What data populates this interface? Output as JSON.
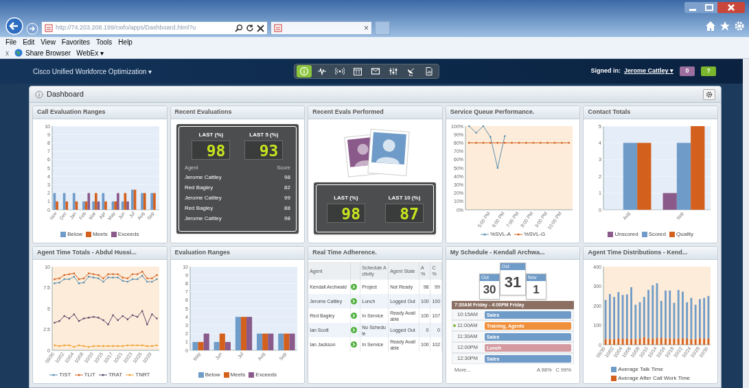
{
  "browser": {
    "url": "http://74.203.208.199/cwfo/apps/Dashboard.html?u",
    "tab_close": "×",
    "menu": [
      "File",
      "Edit",
      "View",
      "Favorites",
      "Tools",
      "Help"
    ],
    "toolbar": {
      "close": "x",
      "share": "Share Browser",
      "webex": "WebEx ▾"
    }
  },
  "app": {
    "title": "Cisco Unified Workforce Optimization ▾",
    "tools": [
      {
        "kind": "info",
        "selected": true
      },
      {
        "kind": "pulse",
        "selected": false
      },
      {
        "kind": "signal",
        "selected": false
      },
      {
        "kind": "calendar",
        "selected": false
      },
      {
        "kind": "mail",
        "selected": false
      },
      {
        "kind": "sliders",
        "selected": false
      },
      {
        "kind": "dish",
        "selected": false
      },
      {
        "kind": "report",
        "selected": false
      }
    ],
    "signed_in_label": "Signed in:",
    "user": "Jerome Cattley ▾",
    "badges": [
      {
        "text": "0",
        "color": "#9c6f9e"
      },
      {
        "text": "?",
        "color": "#7cb62e"
      }
    ]
  },
  "dashboard": {
    "title": "Dashboard",
    "widgets": [
      {
        "kind": "chart",
        "title": "Call Evaluation Ranges",
        "chart_data": {
          "type": "bar",
          "categories": [
            "Nov",
            "Dec",
            "Jan",
            "Feb",
            "Mar",
            "Apr",
            "May",
            "Jun",
            "Jul",
            "Aug",
            "Sep"
          ],
          "grid": true,
          "ylim": [
            0,
            10
          ],
          "yticks": [
            0,
            1,
            2,
            3,
            4,
            5,
            6,
            7,
            8,
            9,
            10
          ],
          "series": [
            {
              "name": "Below",
              "color": "#6f9bc8",
              "values": [
                2,
                2,
                2,
                1,
                1,
                2,
                1,
                1,
                2.4,
                2,
                2
              ]
            },
            {
              "name": "Meets",
              "color": "#d4601e",
              "values": [
                1,
                1,
                1,
                1,
                2,
                1,
                1,
                2,
                2.4,
                2,
                2
              ]
            },
            {
              "name": "Exceeds",
              "color": "#8a5a8a",
              "values": [
                0,
                0,
                0,
                2,
                1,
                0,
                2,
                1,
                0,
                0,
                0
              ]
            }
          ]
        }
      },
      {
        "kind": "scoreboard",
        "title": "Recent Evaluations",
        "scores": [
          {
            "label": "LAST (%)",
            "value": "98"
          },
          {
            "label": "LAST 5 (%)",
            "value": "93"
          }
        ],
        "columns": [
          "Agent",
          "Score"
        ],
        "rows": [
          [
            "Jerome Cattley",
            "98"
          ],
          [
            "Red Bagley",
            "82"
          ],
          [
            "Jerome Cattley",
            "99"
          ],
          [
            "Red Bagley",
            "88"
          ],
          [
            "Jerome Cattley",
            "98"
          ]
        ]
      },
      {
        "kind": "evals",
        "title": "Recent Evals Performed",
        "scores": [
          {
            "label": "LAST (%)",
            "value": "98"
          },
          {
            "label": "LAST 10 (%)",
            "value": "87"
          }
        ]
      },
      {
        "kind": "chart",
        "title": "Service Queue Performance.",
        "chart_data": {
          "type": "line",
          "categories": [
            null,
            null,
            null,
            "5:00 PM",
            null,
            "6:00 PM",
            null,
            "7:00 PM",
            null,
            "8:00 PM",
            null,
            "9:00 PM",
            null,
            "10:00 PM",
            null
          ],
          "ylim": [
            0,
            100
          ],
          "yticks": [
            {
              "value": 0,
              "label": "0%"
            },
            {
              "value": 10,
              "label": "10%"
            },
            {
              "value": 20,
              "label": "20%"
            },
            {
              "value": 30,
              "label": "30%"
            },
            {
              "value": 40,
              "label": "40%"
            },
            {
              "value": 50,
              "label": "50%"
            },
            {
              "value": 60,
              "label": "60%"
            },
            {
              "value": 70,
              "label": "70%"
            },
            {
              "value": 80,
              "label": "80%"
            },
            {
              "value": 90,
              "label": "90%"
            },
            {
              "value": 100,
              "label": "100%"
            }
          ],
          "series": [
            {
              "name": "%SVL-A",
              "color": "#5b8fb0",
              "values": [
                100,
                92,
                100,
                87,
                50,
                88,
                null,
                null,
                null,
                null,
                null,
                null,
                null,
                null,
                null
              ]
            },
            {
              "name": "%SVL-G",
              "color": "#d4601e",
              "values": [
                80,
                80,
                80,
                80,
                80,
                80,
                80,
                80,
                80,
                80,
                80,
                80,
                80,
                80,
                80
              ]
            }
          ]
        }
      },
      {
        "kind": "chart",
        "title": "Contact Totals",
        "chart_data": {
          "type": "bar",
          "categories": [
            "Aug",
            "Sep"
          ],
          "grid": true,
          "ylim": [
            0,
            5
          ],
          "yticks": [
            0,
            1,
            2,
            3,
            4,
            5
          ],
          "series": [
            {
              "name": "Unscored",
              "color": "#8a5a8a",
              "values": [
                0,
                1
              ]
            },
            {
              "name": "Scored",
              "color": "#6f9bc8",
              "values": [
                4,
                4
              ]
            },
            {
              "name": "Quality",
              "color": "#d4601e",
              "values": [
                4,
                5
              ]
            }
          ]
        }
      },
      {
        "kind": "chart",
        "title": "Agent Time Totals - Abdul Hussi...",
        "chart_data": {
          "type": "line",
          "categories": [
            "09/30",
            null,
            "10/02",
            null,
            "10/04",
            null,
            "10/08",
            null,
            "10/10",
            null,
            "10/15",
            null,
            "10/17",
            null,
            "10/21",
            null,
            "10/23",
            null,
            "10/25",
            null,
            "10/29",
            null
          ],
          "ylim": [
            0,
            10
          ],
          "yticks": [
            0,
            2.5,
            5,
            7.5,
            10
          ],
          "series": [
            {
              "name": "TIST",
              "color": "#5b8fb0",
              "values": [
                8.0,
                8.1,
                8.5,
                8.5,
                8.8,
                8.0,
                8.1,
                8.8,
                8.7,
                8.6,
                8.2,
                8.7,
                8.7,
                8.7,
                8.3,
                8.2,
                8.5,
                8.5,
                8.9,
                8.2,
                8.2,
                8.5
              ]
            },
            {
              "name": "TLIT",
              "color": "#d4601e",
              "values": [
                8.5,
                8.6,
                9.0,
                9.1,
                9.2,
                8.5,
                8.6,
                9.2,
                9.1,
                9.0,
                8.6,
                9.1,
                9.1,
                9.1,
                8.7,
                8.6,
                9.1,
                9.1,
                9.4,
                8.6,
                8.6,
                9.0
              ]
            },
            {
              "name": "TRAT",
              "color": "#5a4a6a",
              "values": [
                3.3,
                3.5,
                4.1,
                3.8,
                4.3,
                3.5,
                3.8,
                3.9,
                4.0,
                3.9,
                3.6,
                3.1,
                4.2,
                3.6,
                4.1,
                3.7,
                4.2,
                4.0,
                4.7,
                3.1,
                4.3,
                3.8
              ]
            },
            {
              "name": "TNRT",
              "color": "#f0a030",
              "values": [
                0.6,
                0.5,
                0.6,
                0.6,
                0.4,
                0.6,
                0.5,
                0.4,
                0.5,
                0.5,
                0.5,
                0.5,
                0.5,
                0.5,
                0.5,
                0.6,
                0.6,
                0.6,
                0.6,
                0.5,
                0.5,
                0.6
              ]
            }
          ]
        }
      },
      {
        "kind": "chart",
        "title": "Evaluation Ranges",
        "chart_data": {
          "type": "bar",
          "categories": [
            "May",
            "Jun",
            "Jul",
            "Aug",
            "Sep"
          ],
          "grid": true,
          "ylim": [
            0,
            10
          ],
          "yticks": [
            0,
            1,
            2,
            3,
            4,
            5,
            6,
            7,
            8,
            9,
            10
          ],
          "series": [
            {
              "name": "Below",
              "color": "#6f9bc8",
              "values": [
                1,
                1,
                4,
                2,
                2
              ]
            },
            {
              "name": "Meets",
              "color": "#d4601e",
              "values": [
                1,
                2,
                4,
                2,
                2
              ]
            },
            {
              "name": "Exceeds",
              "color": "#8a5a8a",
              "values": [
                2,
                1,
                4,
                2,
                2
              ]
            }
          ]
        }
      },
      {
        "kind": "table",
        "title": "Real Time Adherence.",
        "columns": [
          "Agent",
          "Schedule Activity",
          "Agent State",
          "A %",
          "C %"
        ],
        "rows": [
          [
            "Kendall Archwald",
            "Project",
            "Not Ready",
            "98",
            "99"
          ],
          [
            "Jerome Cattley",
            "Lunch",
            "Logged Out",
            "100",
            "100"
          ],
          [
            "Red Bagley",
            "In Service",
            "Ready Available",
            "100",
            "107"
          ],
          [
            "Ian Scott",
            "No Schedule",
            "Logged Out",
            "0",
            "0"
          ],
          [
            "Ian Jackson",
            "In Service",
            "Ready Available",
            "100",
            "102"
          ]
        ]
      },
      {
        "kind": "schedule",
        "title": "My Schedule - Kendall Archwa...",
        "dates": [
          {
            "month": "Oct",
            "day": "30",
            "selected": false
          },
          {
            "month": "Oct",
            "day": "31",
            "selected": true
          },
          {
            "month": "Nov",
            "day": "1",
            "selected": false
          }
        ],
        "range": "7:30AM Friday - 4:00PM Friday",
        "entries": [
          {
            "time": "10:15AM",
            "label": "Sales",
            "color": "#6f9bc8",
            "current": false
          },
          {
            "time": "11:00AM",
            "label": "Training, Agents",
            "color": "#f0903a",
            "current": true
          },
          {
            "time": "11:30AM",
            "label": "Sales",
            "color": "#6f9bc8",
            "current": false
          },
          {
            "time": "12:00PM",
            "label": "Lunch",
            "color": "#d49aa0",
            "current": false
          },
          {
            "time": "12:30PM",
            "label": "Sales",
            "color": "#6f9bc8",
            "current": false
          }
        ],
        "more": "More...",
        "adherence": "A 98%",
        "conformance": "C 99%"
      },
      {
        "kind": "chart",
        "title": "Agent Time Distributions - Kend...",
        "chart_data": {
          "type": "bar",
          "stacked": true,
          "categories": [
            "09/30",
            null,
            "10/02",
            null,
            "10/04",
            null,
            "10/06",
            null,
            "10/08",
            null,
            "10/10",
            null,
            "10/14",
            null,
            "10/16",
            null,
            "10/18",
            null,
            "10/22",
            null,
            "10/24",
            null,
            "10/28",
            null,
            "10/30"
          ],
          "ylim": [
            0,
            400
          ],
          "yticks": [
            0,
            100,
            200,
            300,
            400
          ],
          "series": [
            {
              "name": "Average Talk Time",
              "color": "#6f9bc8",
              "values": [
                200,
                230,
                215,
                238,
                223,
                226,
                265,
                175,
                186,
                205,
                248,
                272,
                280,
                190,
                245,
                245,
                183,
                248,
                238,
                186,
                210,
                175,
                200,
                208,
                218
              ]
            },
            {
              "name": "Average After Call Work Time",
              "color": "#d4601e",
              "values": [
                30,
                30,
                30,
                32,
                32,
                32,
                30,
                30,
                32,
                40,
                33,
                33,
                35,
                35,
                33,
                33,
                32,
                33,
                34,
                32,
                30,
                30,
                34,
                32,
                32
              ]
            }
          ]
        }
      }
    ]
  }
}
